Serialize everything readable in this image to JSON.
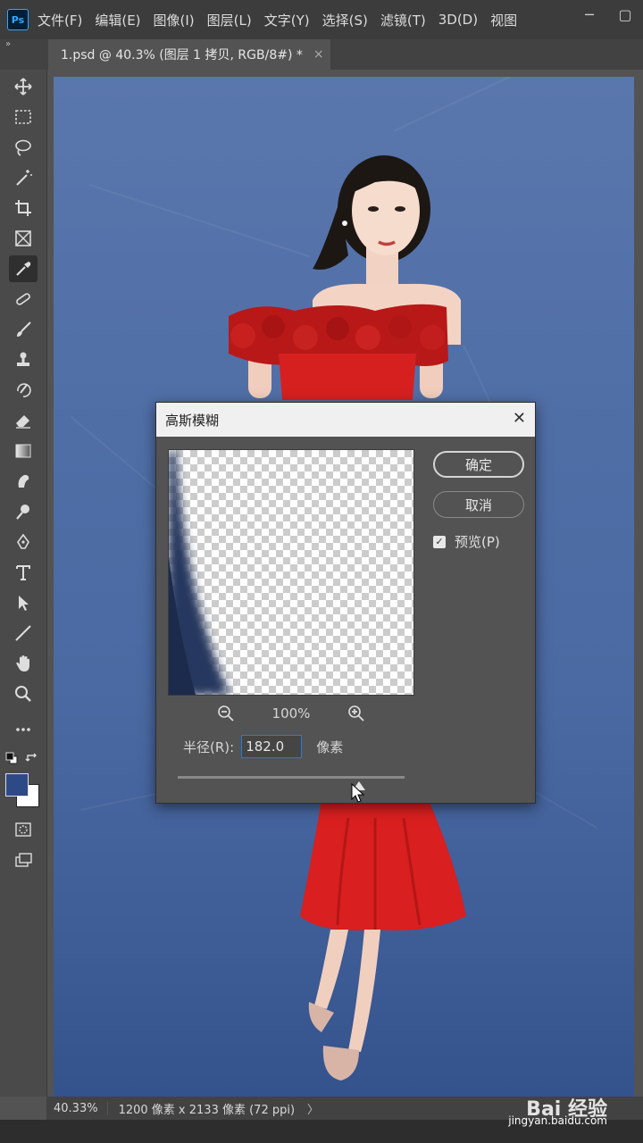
{
  "app": {
    "logo": "Ps"
  },
  "menu": [
    "文件(F)",
    "编辑(E)",
    "图像(I)",
    "图层(L)",
    "文字(Y)",
    "选择(S)",
    "滤镜(T)",
    "3D(D)",
    "视图"
  ],
  "window_controls": {
    "minimize": "─",
    "restore": "▢"
  },
  "tabbar": {
    "collapse": "»",
    "document_tab": "1.psd @ 40.3% (图层 1 拷贝, RGB/8#) *",
    "close": "×"
  },
  "tools": [
    {
      "name": "move-tool",
      "icon": "move-icon"
    },
    {
      "name": "marquee-tool",
      "icon": "rectangle-select-icon"
    },
    {
      "name": "lasso-tool",
      "icon": "lasso-icon"
    },
    {
      "name": "magic-wand-tool",
      "icon": "magic-wand-icon"
    },
    {
      "name": "crop-tool",
      "icon": "crop-icon"
    },
    {
      "name": "frame-tool",
      "icon": "frame-icon"
    },
    {
      "name": "eyedropper-tool",
      "icon": "eyedropper-icon"
    },
    {
      "name": "healing-tool",
      "icon": "healing-icon"
    },
    {
      "name": "brush-tool",
      "icon": "brush-icon"
    },
    {
      "name": "stamp-tool",
      "icon": "stamp-icon"
    },
    {
      "name": "history-brush-tool",
      "icon": "history-brush-icon"
    },
    {
      "name": "eraser-tool",
      "icon": "eraser-icon"
    },
    {
      "name": "gradient-tool",
      "icon": "gradient-icon"
    },
    {
      "name": "smudge-tool",
      "icon": "smudge-icon"
    },
    {
      "name": "dodge-tool",
      "icon": "dodge-icon"
    },
    {
      "name": "pen-tool",
      "icon": "pen-icon"
    },
    {
      "name": "type-tool",
      "icon": "type-icon"
    },
    {
      "name": "path-select-tool",
      "icon": "arrow-select-icon"
    },
    {
      "name": "line-tool",
      "icon": "line-icon"
    },
    {
      "name": "hand-tool",
      "icon": "hand-icon"
    },
    {
      "name": "zoom-tool",
      "icon": "zoom-icon"
    },
    {
      "name": "more-tools",
      "icon": "ellipsis-icon"
    }
  ],
  "colors": {
    "foreground": "#2d4a86",
    "background": "#ffffff",
    "canvas_bg": "#4f6ea6",
    "dress": "#d62020"
  },
  "dialog": {
    "title": "高斯模糊",
    "ok_label": "确定",
    "cancel_label": "取消",
    "preview_label": "预览(P)",
    "preview_checked": true,
    "zoom_level": "100%",
    "radius_label": "半径(R):",
    "radius_value": "182.0",
    "radius_unit": "像素",
    "slider_fraction": 0.8
  },
  "status": {
    "zoom": "40.33%",
    "dimensions": "1200 像素 x 2133 像素 (72 ppi)",
    "arrow": "〉"
  },
  "watermark": {
    "text": "Bai 经验",
    "url": "jingyan.baidu.com"
  }
}
